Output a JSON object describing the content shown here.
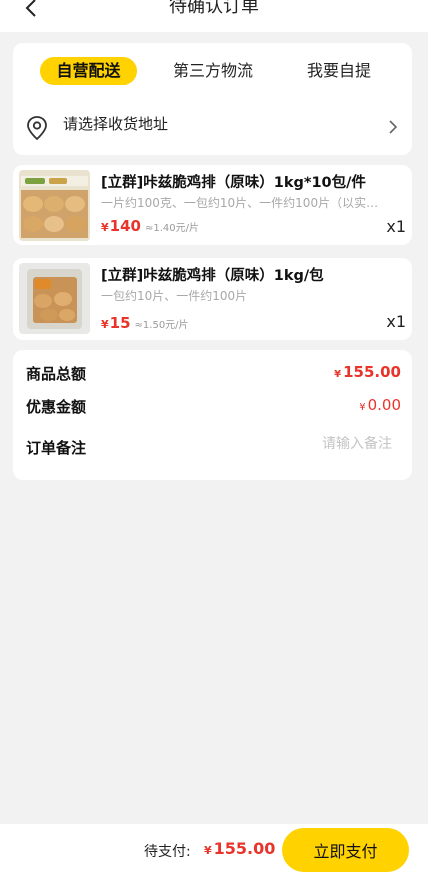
{
  "header": {
    "title": "待确认订单",
    "back_icon": "chevron-left-icon"
  },
  "delivery": {
    "tabs": [
      {
        "label": "自营配送",
        "active": true
      },
      {
        "label": "第三方物流",
        "active": false
      },
      {
        "label": "我要自提",
        "active": false
      }
    ],
    "address_placeholder": "请选择收货地址",
    "address_icon": "location-pin-icon"
  },
  "products": [
    {
      "name": "[立群]咔兹脆鸡排（原味）1kg*10包/件",
      "description": "一片约100克、一包约10片、一件约100片（以实…",
      "price_symbol": "¥",
      "price": "140",
      "unit_price": "≈1.40元/片",
      "quantity": "x1"
    },
    {
      "name": "[立群]咔兹脆鸡排（原味）1kg/包",
      "description": "一包约10片、一件约100片",
      "price_symbol": "¥",
      "price": "15",
      "unit_price": "≈1.50元/片",
      "quantity": "x1"
    }
  ],
  "summary": {
    "total_label": "商品总额",
    "total_symbol": "¥",
    "total_value": "155.00",
    "discount_label": "优惠金额",
    "discount_symbol": "¥",
    "discount_value": "0.00",
    "note_label": "订单备注",
    "note_placeholder": "请输入备注"
  },
  "footer": {
    "pay_label": "待支付:",
    "pay_symbol": "¥",
    "pay_amount": "155.00",
    "pay_button": "立即支付"
  },
  "colors": {
    "accent": "#ffd200",
    "price": "#e8342a",
    "background": "#f2f2f2"
  }
}
